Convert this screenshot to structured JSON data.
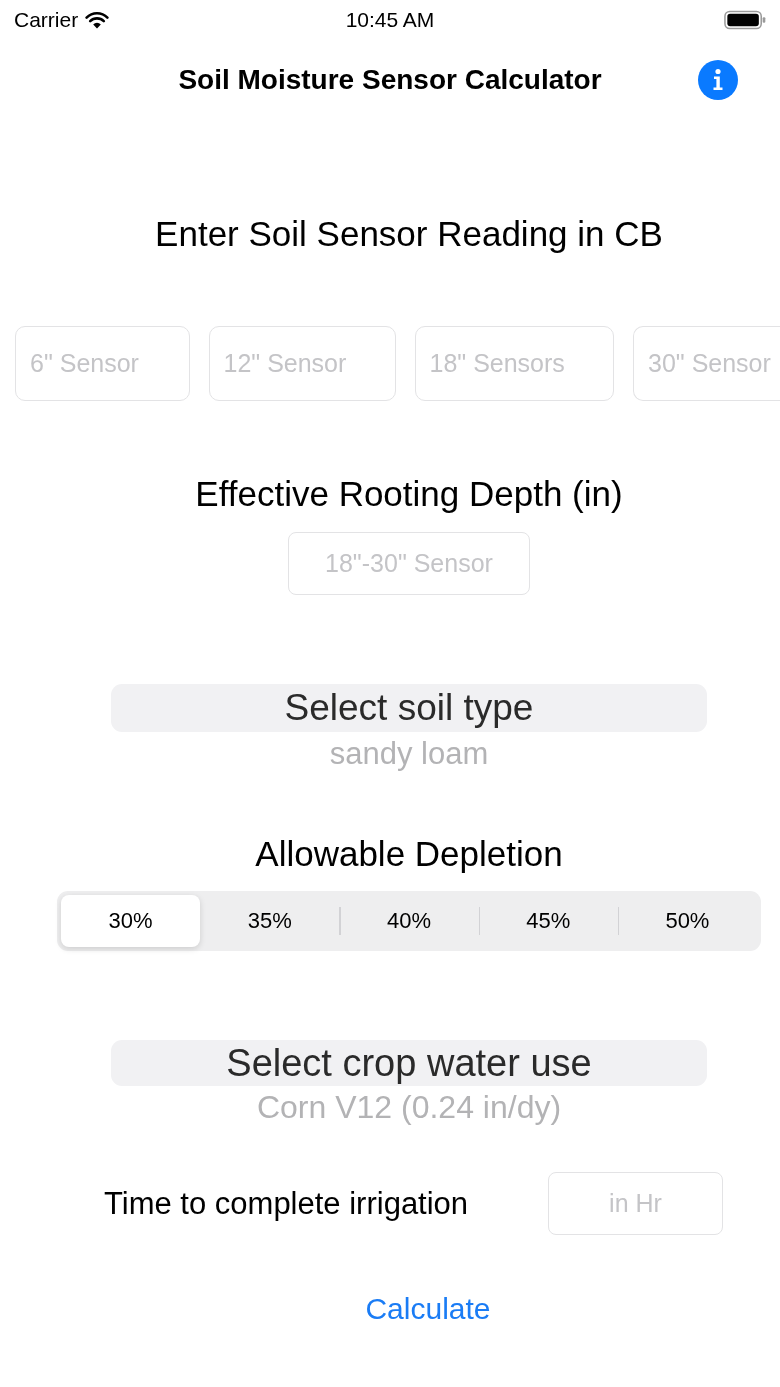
{
  "status_bar": {
    "carrier": "Carrier",
    "time": "10:45 AM"
  },
  "nav": {
    "title": "Soil Moisture Sensor Calculator"
  },
  "sensor_section": {
    "heading": "Enter Soil Sensor Reading in CB",
    "fields": [
      {
        "placeholder": "6\" Sensor"
      },
      {
        "placeholder": "12\" Sensor"
      },
      {
        "placeholder": "18\" Sensors"
      },
      {
        "placeholder": "30\" Sensor"
      }
    ]
  },
  "rooting_depth": {
    "heading": "Effective Rooting Depth (in)",
    "field": {
      "placeholder": "18\"-30\" Sensor"
    }
  },
  "soil_picker": {
    "rows": [
      {
        "label": "Select soil type",
        "selected": true
      },
      {
        "label": "sandy loam",
        "selected": false
      }
    ]
  },
  "depletion": {
    "heading": "Allowable Depletion",
    "segments": [
      {
        "label": "30%",
        "selected": true
      },
      {
        "label": "35%",
        "selected": false
      },
      {
        "label": "40%",
        "selected": false
      },
      {
        "label": "45%",
        "selected": false
      },
      {
        "label": "50%",
        "selected": false
      }
    ]
  },
  "crop_picker": {
    "rows": [
      {
        "label": "Select crop water use",
        "selected": true
      },
      {
        "label": "Corn V12 (0.24 in/dy)",
        "selected": false
      }
    ]
  },
  "irrigation_time": {
    "label": "Time to complete irrigation",
    "field": {
      "placeholder": "in Hr"
    }
  },
  "calculate_button": {
    "label": "Calculate"
  }
}
